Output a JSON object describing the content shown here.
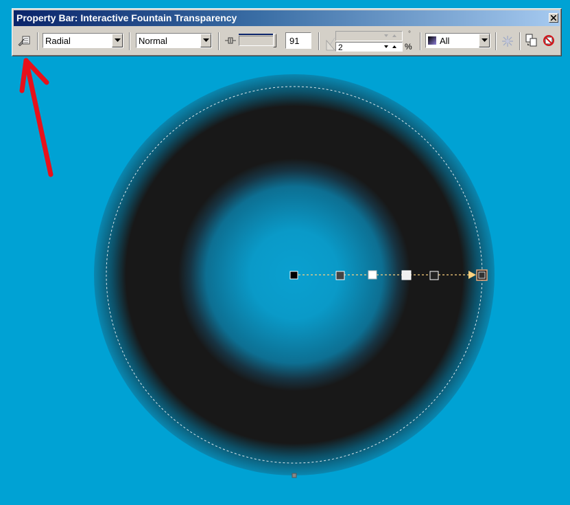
{
  "propbar": {
    "title": "Property Bar: Interactive Fountain Transparency",
    "type_select": "Radial",
    "mode_select": "Normal",
    "midpoint_value": "91",
    "angle_value": "2",
    "percent_label": "%",
    "target_select": "All"
  },
  "colors": {
    "background": "#00a2d4",
    "ring_dark": "#181818",
    "titlebar_start": "#0a246a",
    "titlebar_end": "#a6caf0",
    "arrow_red": "#e8101a",
    "handle_line": "#ffd27f"
  },
  "icons": [
    "edit-transparency-icon",
    "midpoint-slider-icon",
    "edge-pad-icon",
    "freeze-icon",
    "copy-properties-icon",
    "clear-transparency-icon",
    "close-icon",
    "red-annotation-arrow"
  ]
}
